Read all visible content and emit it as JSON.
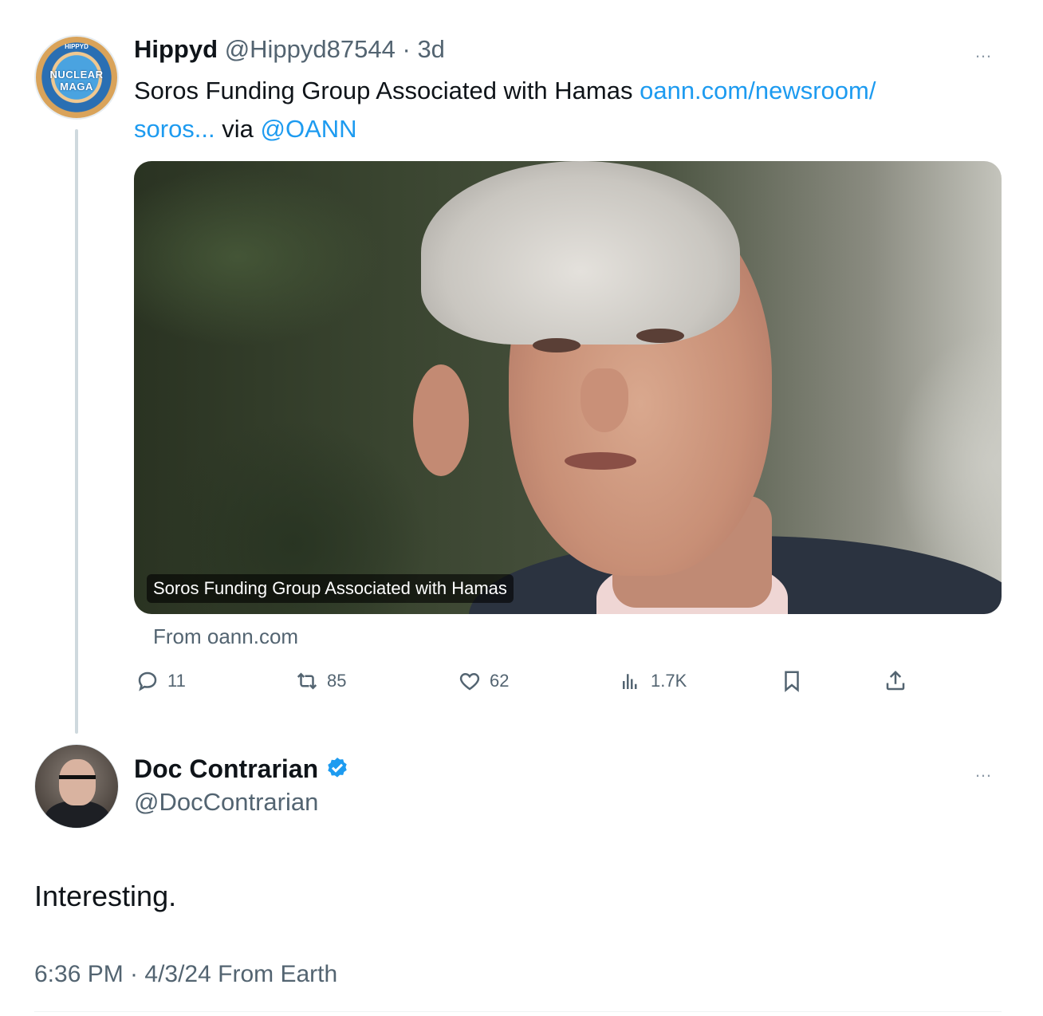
{
  "parent": {
    "avatar_text_top": "HIPPYD",
    "avatar_text_center": "NUCLEAR MAGA",
    "name": "Hippyd",
    "handle": "@Hippyd87544",
    "time": "3d",
    "separator": "·",
    "text_plain": "Soros Funding Group Associated with Hamas ",
    "link_url": "oann.com/newsroom/",
    "link_url2": "soros...",
    "text_via": " via ",
    "mention": "@OANN",
    "more_icon": "…",
    "card": {
      "caption": "Soros Funding Group Associated with Hamas",
      "from": "From oann.com"
    },
    "actions": {
      "replies": "11",
      "reposts": "85",
      "likes": "62",
      "views": "1.7K"
    }
  },
  "reply": {
    "name": "Doc Contrarian",
    "handle": "@DocContrarian",
    "verified_color": "#1d9bf0",
    "more_icon": "…",
    "text": "Interesting.",
    "meta": "6:36 PM · 4/3/24 From Earth"
  },
  "colors": {
    "link": "#1d9bf0",
    "secondary": "#536471",
    "primary": "#0f1419"
  }
}
